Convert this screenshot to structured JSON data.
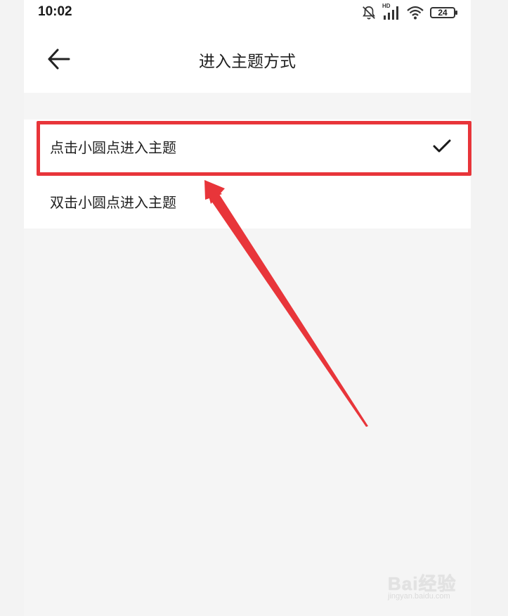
{
  "status_bar": {
    "time": "10:02",
    "network_label": "HD",
    "battery": "24"
  },
  "header": {
    "title": "进入主题方式"
  },
  "options": [
    {
      "label": "点击小圆点进入主题",
      "selected": true
    },
    {
      "label": "双击小圆点进入主题",
      "selected": false
    }
  ],
  "watermark": {
    "brand": "Bai经验",
    "url": "jingyan.baidu.com"
  },
  "colors": {
    "highlight": "#e8353a",
    "background": "#f5f5f5"
  }
}
